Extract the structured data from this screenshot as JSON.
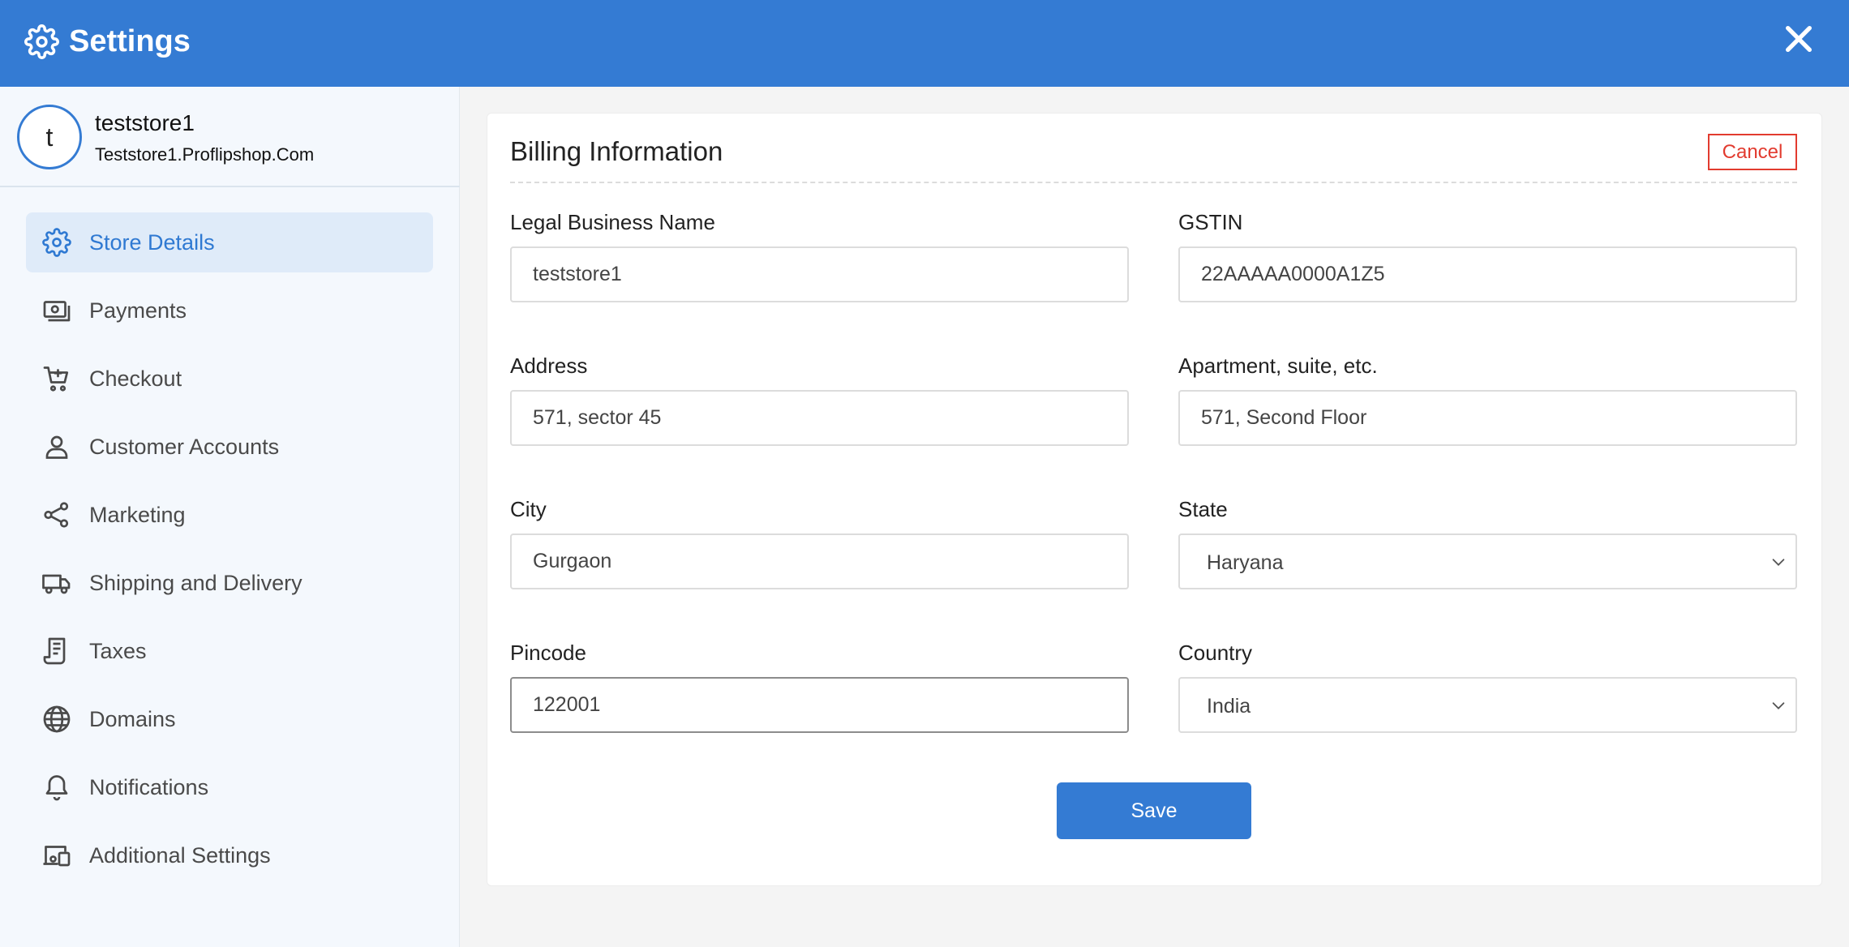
{
  "header": {
    "title": "Settings",
    "icon": "gear-icon",
    "close_icon": "close-icon"
  },
  "profile": {
    "avatar_letter": "t",
    "store_name": "teststore1",
    "store_url": "Teststore1.Proflipshop.Com"
  },
  "sidebar": {
    "items": [
      {
        "label": "Store Details",
        "icon": "gear-icon",
        "active": true
      },
      {
        "label": "Payments",
        "icon": "payments-icon",
        "active": false
      },
      {
        "label": "Checkout",
        "icon": "cart-icon",
        "active": false
      },
      {
        "label": "Customer Accounts",
        "icon": "user-icon",
        "active": false
      },
      {
        "label": "Marketing",
        "icon": "share-icon",
        "active": false
      },
      {
        "label": "Shipping and Delivery",
        "icon": "truck-icon",
        "active": false
      },
      {
        "label": "Taxes",
        "icon": "receipt-icon",
        "active": false
      },
      {
        "label": "Domains",
        "icon": "globe-icon",
        "active": false
      },
      {
        "label": "Notifications",
        "icon": "bell-icon",
        "active": false
      },
      {
        "label": "Additional Settings",
        "icon": "devices-icon",
        "active": false
      }
    ]
  },
  "form": {
    "title": "Billing Information",
    "cancel_label": "Cancel",
    "legal_name": {
      "label": "Legal Business Name",
      "value": "teststore1"
    },
    "gstin": {
      "label": "GSTIN",
      "value": "22AAAAA0000A1Z5"
    },
    "address": {
      "label": "Address",
      "value": "571, sector 45"
    },
    "apartment": {
      "label": "Apartment, suite, etc.",
      "value": "571, Second Floor"
    },
    "city": {
      "label": "City",
      "value": "Gurgaon"
    },
    "state": {
      "label": "State",
      "value": "Haryana"
    },
    "pincode": {
      "label": "Pincode",
      "value": "122001"
    },
    "country": {
      "label": "Country",
      "value": "India"
    },
    "save_label": "Save"
  },
  "colors": {
    "brand": "#347bd3",
    "cancel": "#e23b2f",
    "sidebar_bg": "#f4f8fd",
    "active_bg": "#dfebf9"
  }
}
